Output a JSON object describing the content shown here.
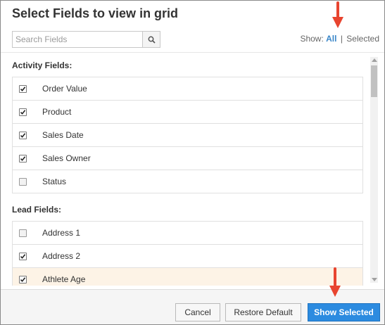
{
  "dialog": {
    "title": "Select Fields to view in grid"
  },
  "search": {
    "placeholder": "Search Fields",
    "value": ""
  },
  "show_filter": {
    "label": "Show:",
    "all": "All",
    "separator": "|",
    "selected": "Selected",
    "active": "All"
  },
  "sections": [
    {
      "heading": "Activity Fields:",
      "fields": [
        {
          "label": "Order Value",
          "checked": true
        },
        {
          "label": "Product",
          "checked": true
        },
        {
          "label": "Sales Date",
          "checked": true
        },
        {
          "label": "Sales Owner",
          "checked": true
        },
        {
          "label": "Status",
          "checked": false
        }
      ]
    },
    {
      "heading": "Lead Fields:",
      "fields": [
        {
          "label": "Address 1",
          "checked": false
        },
        {
          "label": "Address 2",
          "checked": true
        },
        {
          "label": "Athlete Age",
          "checked": true,
          "highlighted": true
        }
      ]
    }
  ],
  "footer": {
    "cancel_label": "Cancel",
    "restore_label": "Restore Default",
    "show_selected_label": "Show Selected"
  },
  "colors": {
    "accent": "#2c8be0",
    "link": "#3b87c9",
    "annotation": "#e8442f",
    "highlight_row": "#fdf3e6"
  },
  "icons": {
    "search": "magnifier-icon",
    "check": "checkmark-icon",
    "annotation": "red-arrow-down-icon"
  }
}
